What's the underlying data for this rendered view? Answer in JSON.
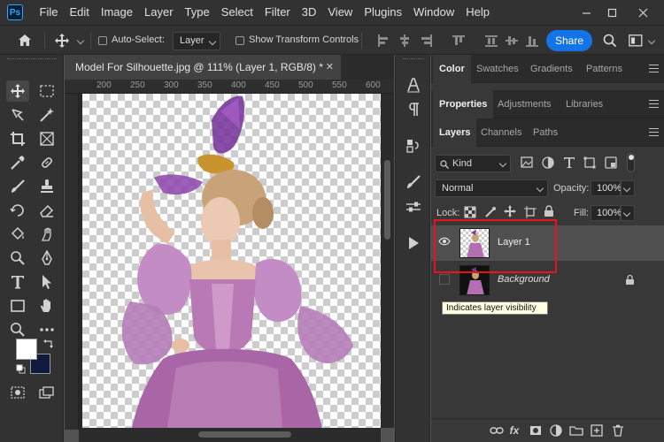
{
  "app": {
    "logo": "Ps"
  },
  "menu": [
    "File",
    "Edit",
    "Image",
    "Layer",
    "Type",
    "Select",
    "Filter",
    "3D",
    "View",
    "Plugins",
    "Window",
    "Help"
  ],
  "options_bar": {
    "auto_select_label": "Auto-Select:",
    "auto_select_target": "Layer",
    "show_transform_label": "Show Transform Controls",
    "share_label": "Share"
  },
  "document": {
    "tab_title": "Model For  Silhouette.jpg @ 111% (Layer 1, RGB/8) *",
    "close_glyph": "✕",
    "ruler_labels": [
      "200",
      "250",
      "300",
      "350",
      "400",
      "450",
      "500",
      "550",
      "600"
    ]
  },
  "panels": {
    "top_tabs": [
      "Color",
      "Swatches",
      "Gradients",
      "Patterns"
    ],
    "mid_tabs": [
      "Properties",
      "Adjustments",
      "Libraries"
    ],
    "layer_tabs": [
      "Layers",
      "Channels",
      "Paths"
    ],
    "filter_kind": "Kind",
    "blend_mode": "Normal",
    "opacity_label": "Opacity:",
    "opacity_value": "100%",
    "lock_label": "Lock:",
    "fill_label": "Fill:",
    "fill_value": "100%",
    "layers": [
      {
        "name": "Layer 1",
        "visible": true,
        "selected": true
      },
      {
        "name": "Background",
        "visible": false,
        "locked": true
      }
    ],
    "tooltip": "Indicates layer visibility",
    "footer_icons": [
      "link-icon",
      "fx-icon",
      "mask-icon",
      "adjustment-icon",
      "group-icon",
      "new-layer-icon",
      "trash-icon"
    ]
  },
  "colors": {
    "accent": "#1473e6",
    "highlight_box": "#e8141b",
    "foreground": "#ffffff",
    "background": "#0f1a3c"
  }
}
